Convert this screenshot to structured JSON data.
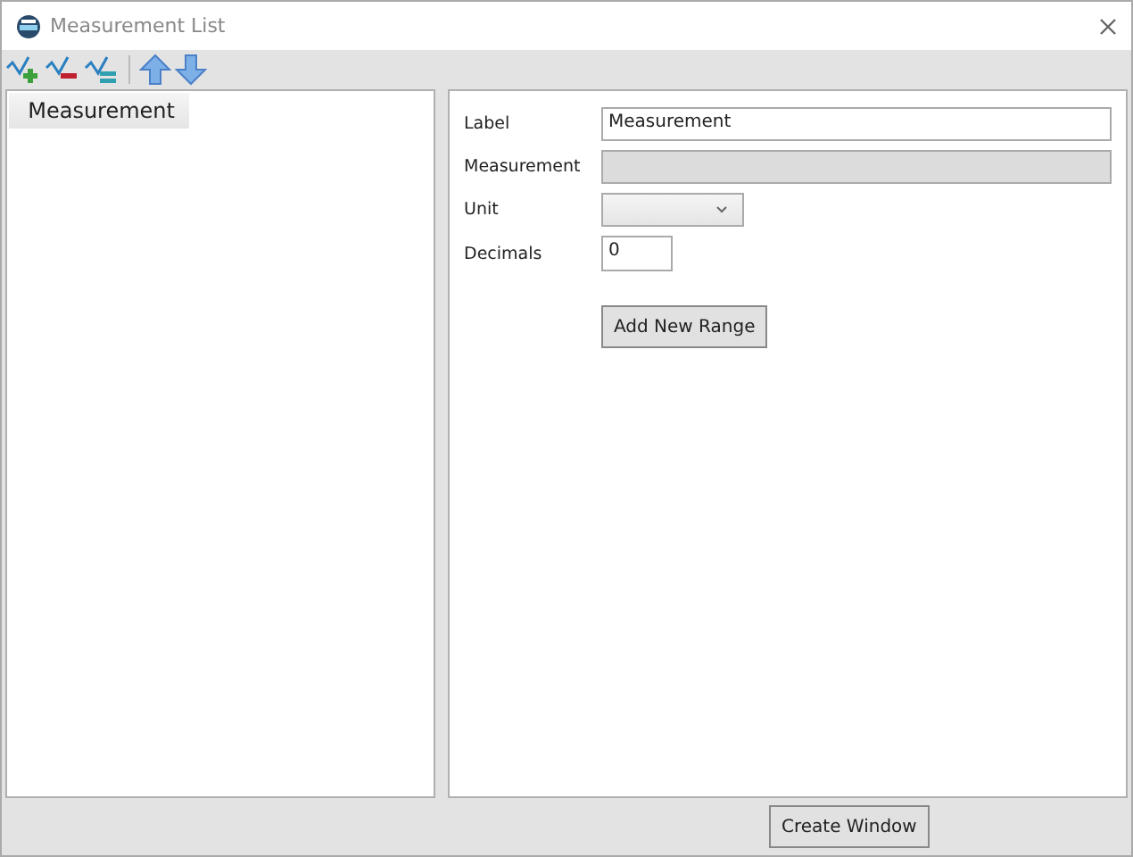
{
  "window": {
    "title": "Measurement List"
  },
  "toolbar": [
    {
      "kind": "add"
    },
    {
      "kind": "remove"
    },
    {
      "kind": "edit"
    },
    {
      "kind": "up"
    },
    {
      "kind": "down"
    }
  ],
  "list": [
    {
      "label": "Measurement",
      "selected": true
    }
  ],
  "form": [
    {
      "kind": "text",
      "label": "Label",
      "value": "Measurement"
    },
    {
      "kind": "disabled",
      "label": "Measurement"
    },
    {
      "kind": "select",
      "label": "Unit"
    },
    {
      "kind": "number",
      "label": "Decimals",
      "value": "0"
    }
  ],
  "range_button": "Add New Range",
  "footer_button": "Create Window"
}
